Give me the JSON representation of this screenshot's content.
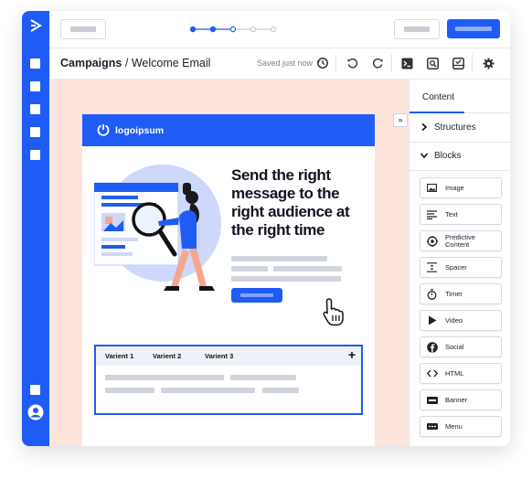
{
  "header": {
    "breadcrumb_section": "Campaigns",
    "breadcrumb_separator": " / ",
    "breadcrumb_page": "Welcome Email",
    "save_status": "Saved just now"
  },
  "steps": {
    "total": 5,
    "completed": 2,
    "current": 3
  },
  "email": {
    "logo_text": "logoipsum",
    "headline": "Send the right message to the right audience at the right time",
    "variants": [
      "Varient 1",
      "Varient 2",
      "Varient 3"
    ],
    "add_symbol": "+"
  },
  "panel": {
    "tab_label": "Content",
    "structures_label": "Structures",
    "blocks_label": "Blocks",
    "blocks": [
      {
        "label": "Image",
        "icon": "image-icon"
      },
      {
        "label": "Text",
        "icon": "text-icon"
      },
      {
        "label": "Predictive Content",
        "icon": "predictive-content-icon"
      },
      {
        "label": "Spacer",
        "icon": "spacer-icon"
      },
      {
        "label": "Timer",
        "icon": "timer-icon"
      },
      {
        "label": "Video",
        "icon": "video-icon"
      },
      {
        "label": "Social",
        "icon": "social-icon"
      },
      {
        "label": "HTML",
        "icon": "html-icon"
      },
      {
        "label": "Banner",
        "icon": "banner-icon"
      },
      {
        "label": "Menu",
        "icon": "menu-icon"
      }
    ]
  },
  "colors": {
    "accent": "#1f5cf5",
    "canvas": "#fde5dc",
    "figure_skin": "#f6a68e",
    "placeholder": "#d0d4dc"
  }
}
